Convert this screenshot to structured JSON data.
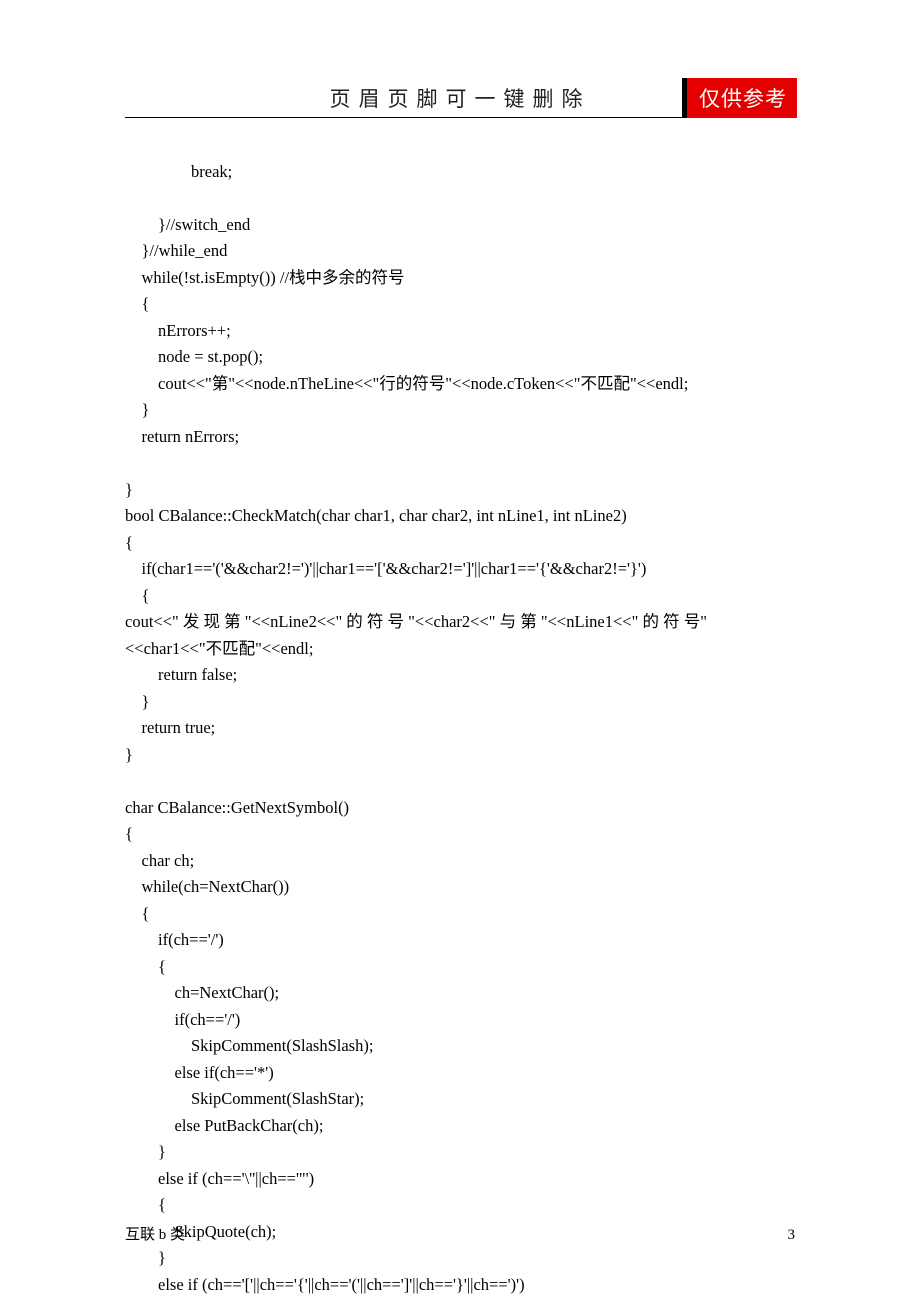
{
  "header": {
    "title": "页眉页脚可一键删除",
    "badge": "仅供参考"
  },
  "code": {
    "l01": "                break;",
    "l02": "",
    "l03": "        }//switch_end",
    "l04": "    }//while_end",
    "l05": "    while(!st.isEmpty()) //栈中多余的符号",
    "l06": "    {",
    "l07": "        nErrors++;",
    "l08": "        node = st.pop();",
    "l09": "        cout<<\"第\"<<node.nTheLine<<\"行的符号\"<<node.cToken<<\"不匹配\"<<endl;",
    "l10": "    }",
    "l11": "    return nErrors;",
    "l12": "",
    "l13": "}",
    "l14": "bool CBalance::CheckMatch(char char1, char char2, int nLine1, int nLine2)",
    "l15": "{",
    "l16": "    if(char1=='('&&char2!=')'||char1=='['&&char2!=']'||char1=='{'&&char2!='}')",
    "l17": "    {",
    "l18": "        cout<<\" 发 现 第 \"<<nLine2<<\" 的 符 号 \"<<char2<<\" 与 第 \"<<nLine1<<\" 的 符 号\"<<char1<<\"不匹配\"<<endl;",
    "l19": "        return false;",
    "l20": "    }",
    "l21": "    return true;",
    "l22": "}",
    "l23": "",
    "l24": "char CBalance::GetNextSymbol()",
    "l25": "{",
    "l26": "    char ch;",
    "l27": "    while(ch=NextChar())",
    "l28": "    {",
    "l29": "        if(ch=='/')",
    "l30": "        {",
    "l31": "            ch=NextChar();",
    "l32": "            if(ch=='/')",
    "l33": "                SkipComment(SlashSlash);",
    "l34": "            else if(ch=='*')",
    "l35": "                SkipComment(SlashStar);",
    "l36": "            else PutBackChar(ch);",
    "l37": "        }",
    "l38": "        else if (ch=='\\''||ch=='\"')",
    "l39": "        {",
    "l40": "            SkipQuote(ch);",
    "l41": "        }",
    "l42": "        else if (ch=='['||ch=='{'||ch=='('||ch==']'||ch=='}'||ch==')')"
  },
  "footer": {
    "left": "互联 b 类",
    "page": "3"
  }
}
